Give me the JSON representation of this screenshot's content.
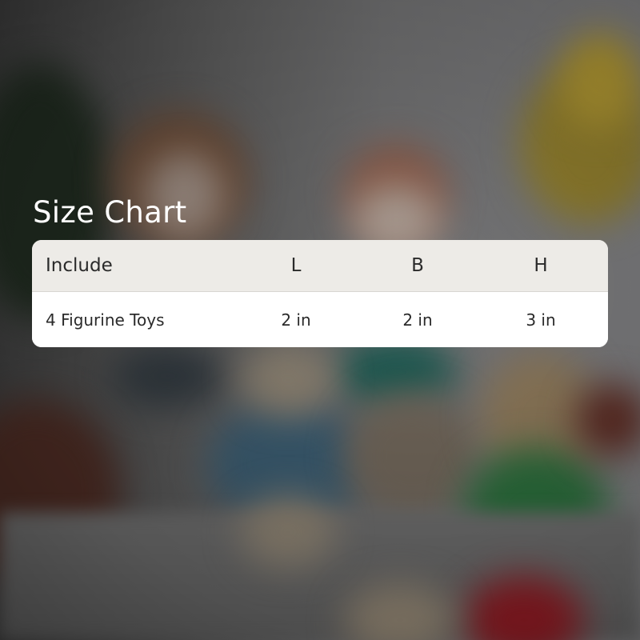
{
  "title": "Size Chart",
  "table": {
    "columns": [
      "Include",
      "L",
      "B",
      "H"
    ],
    "rows": [
      [
        "4 Figurine Toys",
        "2 in",
        "2 in",
        "3 in"
      ]
    ]
  },
  "colors": {
    "header_bg": "#edebe7",
    "body_bg": "#ffffff",
    "title_color": "#ffffff",
    "text_color": "#2a2a2a"
  }
}
